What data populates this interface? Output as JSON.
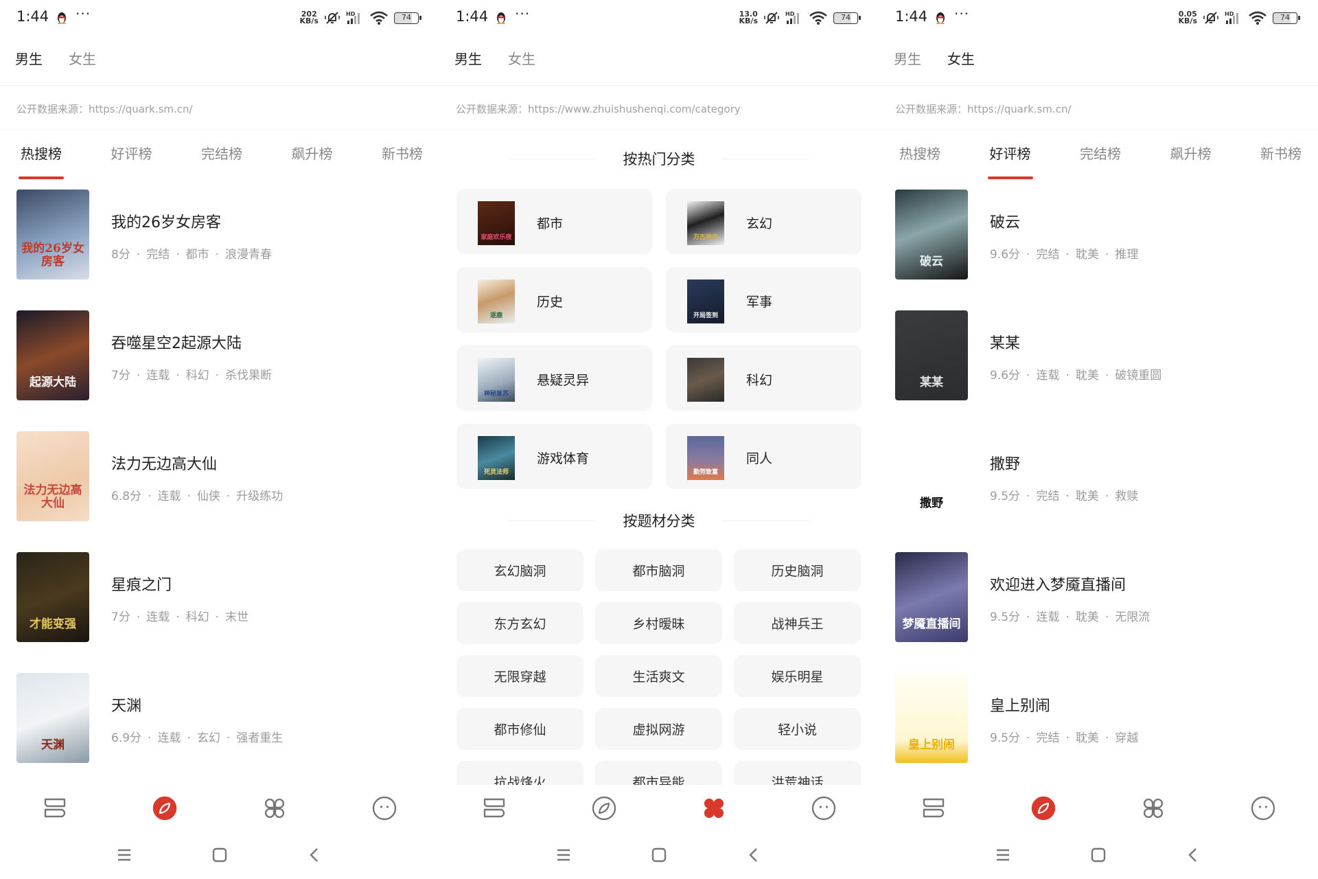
{
  "colors": {
    "accent": "#d9392b",
    "text": "#222222",
    "muted": "#9c9c9c",
    "card_bg": "#f6f6f6"
  },
  "panels": [
    {
      "status": {
        "time": "1:44",
        "speed_top": "202",
        "speed_bottom": "KB/s",
        "battery": "74"
      },
      "gender_tabs": [
        {
          "label": "男生",
          "active": true
        },
        {
          "label": "女生",
          "active": false
        }
      ],
      "source": "公开数据来源：https://quark.sm.cn/",
      "rank_tabs": [
        {
          "label": "热搜榜",
          "active": true
        },
        {
          "label": "好评榜",
          "active": false
        },
        {
          "label": "完结榜",
          "active": false
        },
        {
          "label": "飙升榜",
          "active": false
        },
        {
          "label": "新书榜",
          "active": false
        }
      ],
      "books": [
        {
          "title": "我的26岁女房客",
          "score": "8分",
          "status": "完结",
          "genre": "都市",
          "tag": "浪漫青春",
          "cover_text": "我的26岁女房客",
          "cover_bg": "linear-gradient(160deg,#3b4a63,#8aa3c2 55%,#d8dde6)",
          "cover_color": "#c23a2a"
        },
        {
          "title": "吞噬星空2起源大陆",
          "score": "7分",
          "status": "连载",
          "genre": "科幻",
          "tag": "杀伐果断",
          "cover_text": "起源大陆",
          "cover_bg": "linear-gradient(160deg,#1d1a2a,#8a4a2a 50%,#2a2030)",
          "cover_color": "#f4f4f4"
        },
        {
          "title": "法力无边高大仙",
          "score": "6.8分",
          "status": "连载",
          "genre": "仙侠",
          "tag": "升级练功",
          "cover_text": "法力无边高大仙",
          "cover_bg": "linear-gradient(160deg,#f6e0cc,#eec9a8 60%,#f4dcc6)",
          "cover_color": "#c4483a"
        },
        {
          "title": "星痕之门",
          "score": "7分",
          "status": "连载",
          "genre": "科幻",
          "tag": "末世",
          "cover_text": "才能变强",
          "cover_bg": "linear-gradient(160deg,#2a2418,#4a3a1e 50%,#1a1410)",
          "cover_color": "#e8c860"
        },
        {
          "title": "天渊",
          "score": "6.9分",
          "status": "连载",
          "genre": "玄幻",
          "tag": "强者重生",
          "cover_text": "天渊",
          "cover_bg": "linear-gradient(160deg,#dfe6ec,#f2f4f6 50%,#8a9aa6)",
          "cover_color": "#8a2a1a"
        }
      ],
      "bottom_nav_active": 1
    },
    {
      "status": {
        "time": "1:44",
        "speed_top": "13.0",
        "speed_bottom": "KB/s",
        "battery": "74"
      },
      "gender_tabs": [
        {
          "label": "男生",
          "active": true
        },
        {
          "label": "女生",
          "active": false
        }
      ],
      "source": "公开数据来源：https://www.zhuishushenqi.com/category",
      "hot_heading": "按热门分类",
      "hot_categories": [
        {
          "label": "都市",
          "cover_text": "家庭欢乐夜",
          "cover_bg": "linear-gradient(160deg,#5a2a18,#2a0e08)",
          "cover_color": "#e0507a"
        },
        {
          "label": "玄幻",
          "cover_text": "万古神帝",
          "cover_bg": "linear-gradient(160deg,#f4f4f4,#202020 45%,#f0f0f0)",
          "cover_color": "#d8b24a"
        },
        {
          "label": "历史",
          "cover_text": "逐鹿",
          "cover_bg": "linear-gradient(160deg,#f6efe0,#c89a6a 45%,#e6eef0)",
          "cover_color": "#2a6a4a"
        },
        {
          "label": "军事",
          "cover_text": "开局签到",
          "cover_bg": "linear-gradient(160deg,#2a3a5a,#141c2c)",
          "cover_color": "#f0f0f0"
        },
        {
          "label": "悬疑灵异",
          "cover_text": "神秘复苏",
          "cover_bg": "linear-gradient(160deg,#f0f4f8,#9aaabb 60%,#3a4a5a)",
          "cover_color": "#2a4a8a"
        },
        {
          "label": "科幻",
          "cover_text": "",
          "cover_bg": "linear-gradient(160deg,#3a3a3a,#6a5a4a 50%,#2a2a2a)",
          "cover_color": "#f0f0f0"
        },
        {
          "label": "游戏体育",
          "cover_text": "死灵法师",
          "cover_bg": "linear-gradient(160deg,#1a3a4a,#4a8aa0 50%,#1a2a2a)",
          "cover_color": "#f4d060"
        },
        {
          "label": "同人",
          "cover_text": "勤劳致富",
          "cover_bg": "linear-gradient(180deg,#5a6a9a,#8a7aa0 55%,#e07a4a)",
          "cover_color": "#ffffff"
        }
      ],
      "theme_heading": "按题材分类",
      "theme_tags": [
        "玄幻脑洞",
        "都市脑洞",
        "历史脑洞",
        "东方玄幻",
        "乡村暧昧",
        "战神兵王",
        "无限穿越",
        "生活爽文",
        "娱乐明星",
        "都市修仙",
        "虚拟网游",
        "轻小说",
        "抗战烽火",
        "都市异能",
        "洪荒神话"
      ],
      "bottom_nav_active": 2
    },
    {
      "status": {
        "time": "1:44",
        "speed_top": "0.05",
        "speed_bottom": "KB/s",
        "battery": "74"
      },
      "gender_tabs": [
        {
          "label": "男生",
          "active": false
        },
        {
          "label": "女生",
          "active": true
        }
      ],
      "source": "公开数据来源：https://quark.sm.cn/",
      "rank_tabs": [
        {
          "label": "热搜榜",
          "active": false
        },
        {
          "label": "好评榜",
          "active": true
        },
        {
          "label": "完结榜",
          "active": false
        },
        {
          "label": "飙升榜",
          "active": false
        },
        {
          "label": "新书榜",
          "active": false
        }
      ],
      "books": [
        {
          "title": "破云",
          "score": "9.6分",
          "status": "完结",
          "genre": "耽美",
          "tag": "推理",
          "cover_text": "破云",
          "cover_bg": "linear-gradient(160deg,#2a3a40,#8aa6aa 45%,#141414)",
          "cover_color": "#e6f0f0"
        },
        {
          "title": "某某",
          "score": "9.6分",
          "status": "连载",
          "genre": "耽美",
          "tag": "破镜重圆",
          "cover_text": "某某",
          "cover_bg": "linear-gradient(160deg,#3a3c40,#2a2c30)",
          "cover_color": "#e8e8e8"
        },
        {
          "title": "撒野",
          "score": "9.5分",
          "status": "完结",
          "genre": "耽美",
          "tag": "救赎",
          "cover_text": "撒野",
          "cover_bg": "#ffffff",
          "cover_color": "#111111"
        },
        {
          "title": "欢迎进入梦魇直播间",
          "score": "9.5分",
          "status": "连载",
          "genre": "耽美",
          "tag": "无限流",
          "cover_text": "梦魇直播间",
          "cover_bg": "linear-gradient(160deg,#2a2a4a,#7a7ab0 50%,#3a3a6a)",
          "cover_color": "#ffffff"
        },
        {
          "title": "皇上别闹",
          "score": "9.5分",
          "status": "完结",
          "genre": "耽美",
          "tag": "穿越",
          "cover_text": "皇上别闹",
          "cover_bg": "linear-gradient(180deg,#fffef4,#fff6d0 75%,#f0c020)",
          "cover_color": "#e8b010"
        }
      ],
      "bottom_nav_active": 1
    }
  ],
  "bottom_nav": [
    {
      "name": "bookshelf",
      "icon": "bookshelf-icon"
    },
    {
      "name": "discover",
      "icon": "compass-icon"
    },
    {
      "name": "category",
      "icon": "category-grid-icon"
    },
    {
      "name": "profile",
      "icon": "face-icon"
    }
  ],
  "system_nav": [
    {
      "name": "menu",
      "icon": "menu-icon"
    },
    {
      "name": "home",
      "icon": "home-square-icon"
    },
    {
      "name": "back",
      "icon": "back-chevron-icon"
    }
  ]
}
